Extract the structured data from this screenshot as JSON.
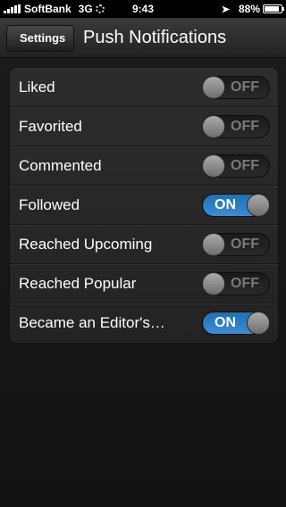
{
  "status_bar": {
    "carrier": "SoftBank",
    "network": "3G",
    "time": "9:43",
    "battery_text": "88%",
    "battery_level": 0.88,
    "icons": [
      "signal-bars-icon",
      "activity-spinner-icon",
      "location-arrow-icon",
      "battery-icon"
    ]
  },
  "nav": {
    "back_label": "Settings",
    "title": "Push Notifications"
  },
  "toggles": {
    "on_label": "ON",
    "off_label": "OFF",
    "on_color": "#2a80c9"
  },
  "settings": [
    {
      "label": "Liked",
      "state": "OFF"
    },
    {
      "label": "Favorited",
      "state": "OFF"
    },
    {
      "label": "Commented",
      "state": "OFF"
    },
    {
      "label": "Followed",
      "state": "ON"
    },
    {
      "label": "Reached Upcoming",
      "state": "OFF"
    },
    {
      "label": "Reached Popular",
      "state": "OFF"
    },
    {
      "label": "Became an Editor's…",
      "state": "ON"
    }
  ]
}
